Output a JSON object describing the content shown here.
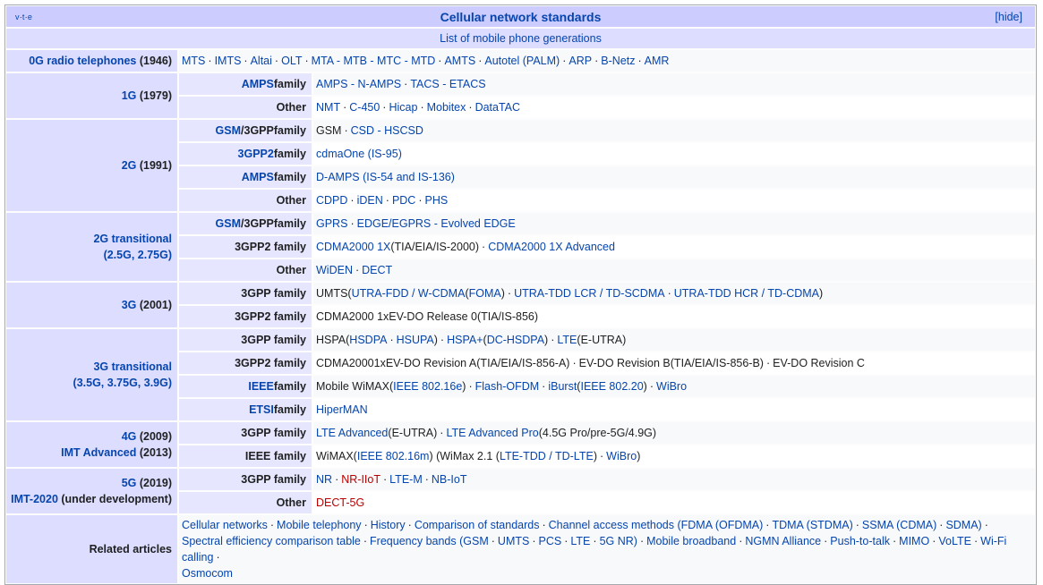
{
  "header": {
    "vte": [
      "v",
      "t",
      "e"
    ],
    "title": "Cellular network standards",
    "hide_label": "[hide]"
  },
  "subtitle": "List of mobile phone generations",
  "rows": {
    "g0": {
      "label_link": "0G radio telephones",
      "label_suffix": " (1946)",
      "items": [
        "MTS",
        "IMTS",
        "Altai",
        "OLT",
        "MTA - MTB - MTC - MTD",
        "AMTS",
        "Autotel (PALM)",
        "ARP",
        "B-Netz",
        "AMR"
      ]
    },
    "g1": {
      "label_link": "1G",
      "label_suffix": " (1979)",
      "subs": [
        {
          "label_link": "AMPS",
          "label_suffix": " family",
          "items": [
            "AMPS - N-AMPS",
            "TACS - ETACS"
          ]
        },
        {
          "label_link": "",
          "label_suffix": "Other",
          "items": [
            "NMT",
            "C-450",
            "Hicap",
            "Mobitex",
            "DataTAC"
          ]
        }
      ]
    },
    "g2": {
      "label_link": "2G",
      "label_suffix": " (1991)",
      "subs": [
        {
          "label_link": "GSM",
          "label_mid": "/3GPP",
          "label_suffix": " family",
          "items": [
            "GSM",
            "CSD - HSCSD"
          ]
        },
        {
          "label_link": "3GPP2",
          "label_suffix": " family",
          "items": [
            "cdmaOne (IS-95)"
          ]
        },
        {
          "label_link": "AMPS",
          "label_suffix": " family",
          "items": [
            "D-AMPS (IS-54 and IS-136)"
          ]
        },
        {
          "label_link": "",
          "label_suffix": "Other",
          "items": [
            "CDPD",
            "iDEN",
            "PDC",
            "PHS"
          ]
        }
      ]
    },
    "g2t": {
      "label_line1": "2G transitional",
      "label_line2": "(2.5G, 2.75G)",
      "subs": [
        {
          "label_link": "GSM",
          "label_mid": "/3GPP",
          "label_suffix": " family",
          "items": [
            "GPRS",
            "EDGE/EGPRS - Evolved EDGE"
          ]
        },
        {
          "label_link": "",
          "label_suffix": "3GPP2 family",
          "items": [
            "CDMA2000 1X",
            "CDMA2000 1X Advanced"
          ],
          "item_notes": [
            " (TIA/EIA/IS-2000)",
            ""
          ]
        },
        {
          "label_link": "",
          "label_suffix": "Other",
          "items": [
            "WiDEN",
            "DECT"
          ]
        }
      ]
    },
    "g3": {
      "label_link": "3G",
      "label_suffix": " (2001)",
      "subs": [
        {
          "label_link": "",
          "label_suffix": "3GPP family",
          "text": {
            "a": "UMTS",
            "b": " (",
            "c": "UTRA-FDD / W-CDMA",
            "d": " (",
            "e": "FOMA",
            "f": ")",
            "g": "UTRA-TDD LCR / TD-SCDMA",
            "h": "UTRA-TDD HCR / TD-CDMA",
            "i": ")"
          }
        },
        {
          "label_link": "",
          "label_suffix": "3GPP2 family",
          "text": {
            "a": "CDMA2000 1xEV-DO Release 0",
            "b": " (TIA/IS-856)"
          }
        }
      ]
    },
    "g3t": {
      "label_line1": "3G transitional",
      "label_line2": "(3.5G, 3.75G, 3.9G)",
      "subs": [
        {
          "label_link": "",
          "label_suffix": "3GPP family",
          "text": {
            "a": "HSPA",
            "b": " (",
            "c": "HSDPA",
            "d": "HSUPA",
            "e": ")",
            "f": "HSPA+",
            "g": " (",
            "h": "DC-HSDPA",
            "i": ")",
            "j": "LTE",
            "k": " (",
            "l": "E-UTRA",
            "m": ")"
          }
        },
        {
          "label_link": "",
          "label_suffix": "3GPP2 family",
          "text": {
            "a": "CDMA2000 ",
            "b": "1xEV-DO Revision A",
            "c": " (TIA/EIA/IS-856-A)",
            "d": "EV-DO Revision B",
            "e": " (TIA/EIA/IS-856-B)",
            "f": "EV-DO Revision C"
          }
        },
        {
          "label_link": "IEEE",
          "label_suffix": " family",
          "text": {
            "a": "Mobile WiMAX",
            "b": " (",
            "c": "IEEE 802.16e",
            "d": ")",
            "e": "Flash-OFDM",
            "f": "iBurst",
            "g": " (",
            "h": "IEEE 802.20",
            "i": ")",
            "j": "WiBro"
          }
        },
        {
          "label_link": "ETSI",
          "label_suffix": " family",
          "items": [
            "HiperMAN"
          ]
        }
      ]
    },
    "g4": {
      "label1_link": "4G",
      "label1_suffix": " (2009)",
      "label2_link": "IMT Advanced",
      "label2_suffix": " (2013)",
      "subs": [
        {
          "label_link": "",
          "label_suffix": "3GPP family",
          "text": {
            "a": "LTE Advanced",
            "b": " (",
            "c": "E-UTRA",
            "d": ")",
            "e": "LTE Advanced Pro",
            "f": " (4.5G Pro/pre-5G/4.9G)"
          }
        },
        {
          "label_link": "",
          "label_suffix": "IEEE family",
          "text": {
            "a": "WiMAX",
            "b": " (",
            "c": "IEEE 802.16m",
            "d": ") (WiMax 2.1 (",
            "e": "LTE-TDD / TD-LTE",
            "f": ")",
            "g": "WiBro",
            "h": ")"
          }
        }
      ]
    },
    "g5": {
      "label1_link": "5G",
      "label1_suffix": " (2019)",
      "label2_link": "IMT-2020",
      "label2_suffix": " (under development)",
      "subs": [
        {
          "label_link": "",
          "label_suffix": "3GPP family",
          "items": [
            "NR",
            "NR-IIoT",
            "LTE-M",
            "NB-IoT"
          ]
        },
        {
          "label_link": "",
          "label_suffix": "Other",
          "items": [
            "DECT-5G"
          ]
        }
      ]
    },
    "related": {
      "label": "Related articles",
      "line1": [
        "Cellular networks",
        "Mobile telephony",
        "History",
        "Comparison of standards",
        "Channel access methods (FDMA (OFDMA)",
        "TDMA (STDMA)",
        "SSMA (CDMA)",
        "SDMA)"
      ],
      "line2": [
        "Spectral efficiency comparison table",
        "Frequency bands (GSM",
        "UMTS",
        "PCS",
        "LTE",
        "5G NR)",
        "Mobile broadband",
        "NGMN Alliance",
        "Push-to-talk",
        "MIMO",
        "VoLTE",
        "Wi-Fi calling"
      ],
      "line3": [
        "Osmocom"
      ]
    }
  },
  "colors": {
    "title_bg": "#ccccff",
    "group_bg": "#ddddff",
    "sub_bg": "#e6e6ff",
    "link": "#0645ad",
    "redlink": "#ba0000"
  }
}
